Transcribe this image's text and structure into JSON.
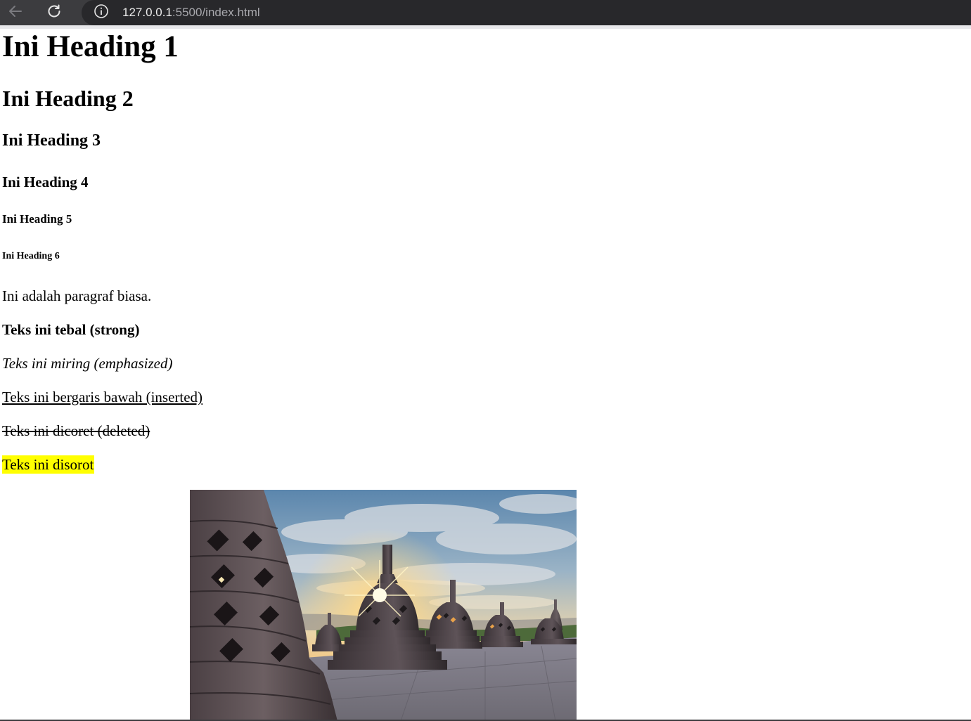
{
  "browser": {
    "url_host": "127.0.0.1",
    "url_path": ":5500/index.html",
    "icons": {
      "back": "arrow-left-icon",
      "reload": "reload-icon",
      "site_info": "info-icon"
    }
  },
  "content": {
    "h1": "Ini Heading 1",
    "h2": "Ini Heading 2",
    "h3": "Ini Heading 3",
    "h4": "Ini Heading 4",
    "h5": "Ini Heading 5",
    "h6": "Ini Heading 6",
    "paragraph": "Ini adalah paragraf biasa.",
    "strong": "Teks ini tebal (strong)",
    "emphasized": "Teks ini miring (emphasized)",
    "inserted": "Teks ini bergaris bawah (inserted)",
    "deleted": "Teks ini dicoret (deleted)",
    "marked": "Teks ini disorot"
  },
  "colors": {
    "highlight": "#ffff00",
    "chrome_bar": "#3c3c3f",
    "omnibox": "#28282b"
  }
}
